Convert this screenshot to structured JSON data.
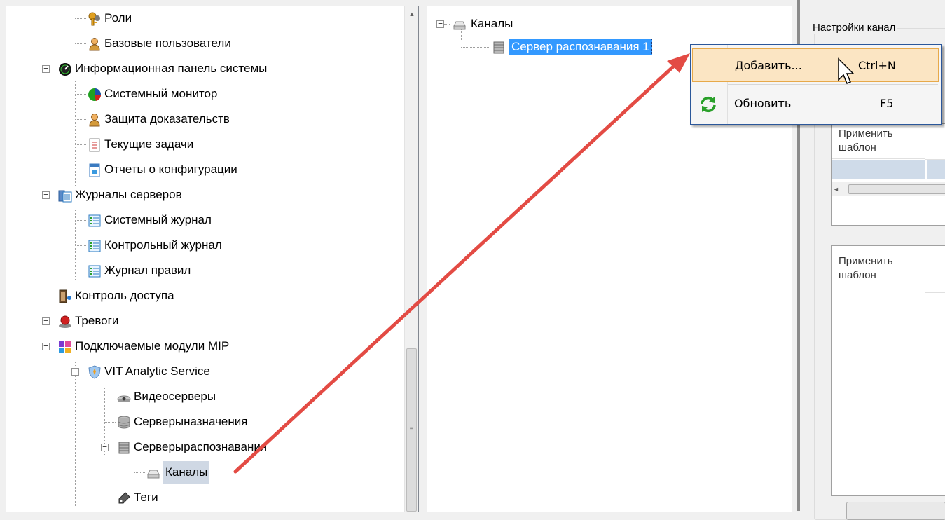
{
  "left_tree": {
    "items": [
      {
        "label": "Роли",
        "icon": "keys-icon"
      },
      {
        "label": "Базовые пользователи",
        "icon": "user-icon"
      },
      {
        "label": "Информационная панель системы",
        "icon": "dashboard-icon"
      },
      {
        "label": "Системный монитор",
        "icon": "pie-chart-icon"
      },
      {
        "label": "Защита доказательств",
        "icon": "user-lock-icon"
      },
      {
        "label": "Текущие задачи",
        "icon": "task-list-icon"
      },
      {
        "label": "Отчеты о конфигурации",
        "icon": "report-icon"
      },
      {
        "label": "Журналы серверов",
        "icon": "server-logs-icon"
      },
      {
        "label": "Системный журнал",
        "icon": "log-icon"
      },
      {
        "label": "Контрольный журнал",
        "icon": "log-icon"
      },
      {
        "label": "Журнал правил",
        "icon": "log-icon"
      },
      {
        "label": "Контроль доступа",
        "icon": "access-door-icon"
      },
      {
        "label": "Тревоги",
        "icon": "alarm-icon"
      },
      {
        "label": "Подключаемые модули MIP",
        "icon": "plugin-puzzle-icon"
      },
      {
        "label": "VIT Analytic Service",
        "icon": "shield-icon"
      },
      {
        "label": "Видеосерверы",
        "icon": "camera-icon"
      },
      {
        "label": "Серверыназначения",
        "icon": "database-icon"
      },
      {
        "label": "Серверыраспознавания",
        "icon": "server-icon"
      },
      {
        "label": "Каналы",
        "icon": "hard-drive-icon"
      },
      {
        "label": "Теги",
        "icon": "tag-icon"
      }
    ]
  },
  "mid_tree": {
    "root": {
      "label": "Каналы",
      "icon": "hard-drive-icon"
    },
    "child": {
      "label": "Сервер распознавания 1",
      "icon": "server-icon"
    }
  },
  "context_menu": {
    "items": [
      {
        "label": "Добавить...",
        "shortcut": "Ctrl+N"
      },
      {
        "label": "Обновить",
        "shortcut": "F5",
        "icon": "refresh-icon"
      }
    ]
  },
  "right_panel": {
    "group_title": "Настройки канал",
    "grid1": {
      "header": [
        "Применить",
        "шаблон"
      ]
    },
    "grid2": {
      "header": [
        "Применить",
        "шаблон"
      ]
    }
  },
  "colors": {
    "selection": "#3399ff",
    "menu_highlight": "#fbe5c3",
    "arrow": "#e34b44"
  }
}
